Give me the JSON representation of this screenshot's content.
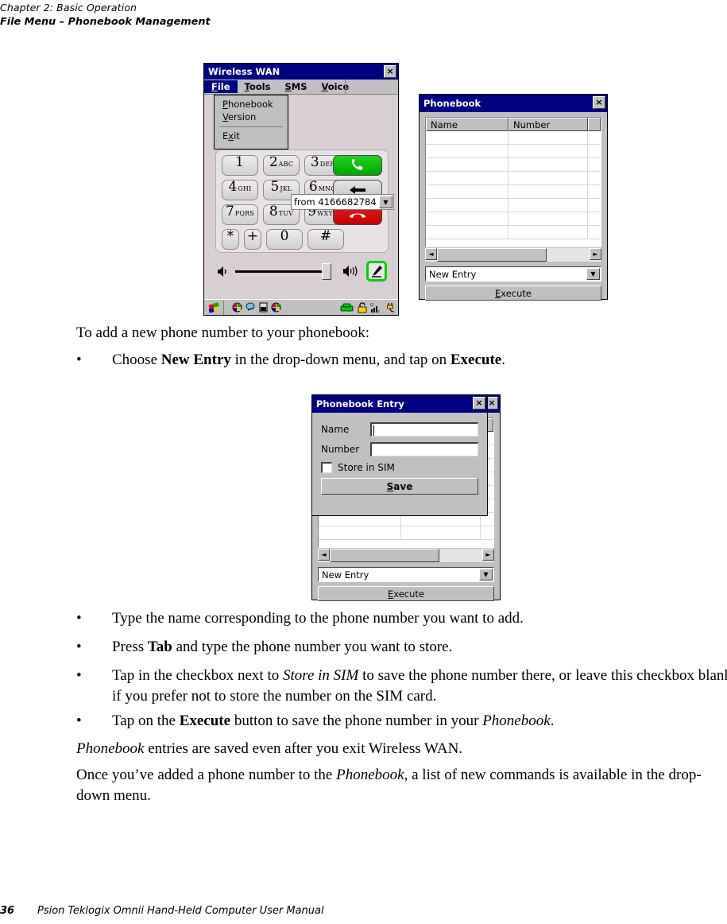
{
  "page": {
    "running_head_chapter": "Chapter 2:  Basic Operation",
    "running_head_section": "File Menu – Phonebook Management",
    "footer_page_number": "36",
    "footer_title": "Psion Teklogix Omnii Hand-Held Computer User Manual"
  },
  "body": {
    "intro": "To add a new phone number to your phonebook:",
    "bullet_dot": "•",
    "b1_a": "Choose ",
    "b1_b": "New Entry",
    "b1_c": " in the drop-down menu, and tap on ",
    "b1_d": "Execute",
    "b1_e": ".",
    "b2": "Type the name corresponding to the phone number you want to add.",
    "b3_a": "Press ",
    "b3_b": "Tab",
    "b3_c": " and type the phone number you want to store.",
    "b4_a": "Tap in the checkbox next to ",
    "b4_b": "Store in SIM",
    "b4_c": " to save the phone number there, or leave this checkbox blank if you prefer not to store the number on the SIM card.",
    "b5_a": "Tap on the ",
    "b5_b": "Execute",
    "b5_c": " button to save the phone number in your ",
    "b5_d": "Phonebook",
    "b5_e": ".",
    "p1_a": "Phonebook",
    "p1_b": " entries are saved even after you exit Wireless WAN.",
    "p2_a": "Once you’ve added a phone number to the ",
    "p2_b": "Phonebook",
    "p2_c": ", a list of new commands is available in the drop-down menu."
  },
  "wireless_wan": {
    "title": "Wireless WAN",
    "close_label": "×",
    "menubar": [
      "File",
      "Tools",
      "SMS",
      "Voice"
    ],
    "menubar_accel": [
      "F",
      "T",
      "S",
      "V"
    ],
    "file_menu": {
      "items": [
        "Phonebook",
        "Version",
        "Exit"
      ],
      "accel": [
        "P",
        "V",
        "x"
      ]
    },
    "from_dropdown_value": "from 4166682784",
    "dropdown_arrow": "▼",
    "keys": [
      {
        "digit": "1",
        "letters": ""
      },
      {
        "digit": "2",
        "letters": "ABC"
      },
      {
        "digit": "3",
        "letters": "DEF"
      },
      {
        "digit": "4",
        "letters": "GHI"
      },
      {
        "digit": "5",
        "letters": "JKL"
      },
      {
        "digit": "6",
        "letters": "MNO"
      },
      {
        "digit": "7",
        "letters": "PQRS"
      },
      {
        "digit": "8",
        "letters": "TUV"
      },
      {
        "digit": "9",
        "letters": "WXYZ"
      },
      {
        "digit": "*",
        "letters": ""
      },
      {
        "digit": "+",
        "letters": ""
      },
      {
        "digit": "0",
        "letters": ""
      },
      {
        "digit": "#",
        "letters": ""
      }
    ],
    "call_buttons": [
      "send-call",
      "backspace",
      "end-call"
    ],
    "volume_icon_low": "speaker-low-icon",
    "volume_icon_high": "speaker-high-icon",
    "mic_button": "microphone-icon",
    "taskbar_icons": [
      "start-icon",
      "network-icon",
      "desktop-icon",
      "battery-icon",
      "network2-icon",
      "phone-icon",
      "lock-icon",
      "signal-icon",
      "power-icon"
    ]
  },
  "phonebook": {
    "title": "Phonebook",
    "close_label": "×",
    "columns": [
      "Name",
      "Number"
    ],
    "rows": [],
    "row_count": 8,
    "scroll_left": "◄",
    "scroll_right": "►",
    "combo_value": "New Entry",
    "combo_arrow": "▼",
    "execute_label_accel": "E",
    "execute_label_rest": "xecute"
  },
  "phonebook_entry": {
    "title": "Phonebook Entry",
    "close_label": "×",
    "name_label": "Name",
    "name_value": "",
    "number_label": "Number",
    "number_value": "",
    "checkbox_label": "Store in SIM",
    "checkbox_checked": false,
    "save_label_accel": "S",
    "save_label_rest": "ave"
  },
  "colors": {
    "titlebar": "#000080",
    "window_face": "#c0c0c0",
    "wan_face": "#d8cfd4",
    "call_green": "#00a800",
    "call_red": "#c00000",
    "mic_green": "#00d000"
  }
}
